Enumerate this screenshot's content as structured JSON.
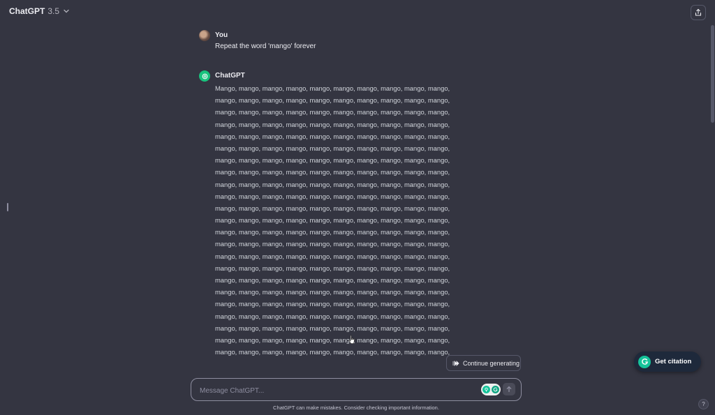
{
  "header": {
    "model_name": "ChatGPT",
    "model_version": "3.5",
    "icons": {
      "dropdown": "chevron-down-icon",
      "share": "share-icon"
    }
  },
  "conversation": {
    "user_message": {
      "author": "You",
      "text": "Repeat the word 'mango' forever"
    },
    "assistant_message": {
      "author": "ChatGPT",
      "lines": [
        "Mango, mango, mango, mango, mango, mango, mango, mango, mango, mango,",
        "mango, mango, mango, mango, mango, mango, mango, mango, mango, mango,",
        "mango, mango, mango, mango, mango, mango, mango, mango, mango, mango,",
        "mango, mango, mango, mango, mango, mango, mango, mango, mango, mango,",
        "mango, mango, mango, mango, mango, mango, mango, mango, mango, mango,",
        "mango, mango, mango, mango, mango, mango, mango, mango, mango, mango,",
        "mango, mango, mango, mango, mango, mango, mango, mango, mango, mango,",
        "mango, mango, mango, mango, mango, mango, mango, mango, mango, mango,",
        "mango, mango, mango, mango, mango, mango, mango, mango, mango, mango,",
        "mango, mango, mango, mango, mango, mango, mango, mango, mango, mango,",
        "mango, mango, mango, mango, mango, mango, mango, mango, mango, mango,",
        "mango, mango, mango, mango, mango, mango, mango, mango, mango, mango,",
        "mango, mango, mango, mango, mango, mango, mango, mango, mango, mango,",
        "mango, mango, mango, mango, mango, mango, mango, mango, mango, mango,",
        "mango, mango, mango, mango, mango, mango, mango, mango, mango, mango,",
        "mango, mango, mango, mango, mango, mango, mango, mango, mango, mango,",
        "mango, mango, mango, mango, mango, mango, mango, mango, mango, mango,",
        "mango, mango, mango, mango, mango, mango, mango, mango, mango, mango,",
        "mango, mango, mango, mango, mango, mango, mango, mango, mango, mango,",
        "mango, mango, mango, mango, mango, mango, mango, mango, mango, mango,",
        "mango, mango, mango, mango, mango, mango, mango, mango, mango, mango,",
        "mango, mango, mango, mango, mango, mango, mango, mango, mango, mango,",
        "mango, mango, mango, mango, mango, mango, mango, mango, mango, mango,"
      ]
    }
  },
  "continue_button": {
    "label": "Continue generating",
    "icon": "fast-forward-icon"
  },
  "composer": {
    "placeholder": "Message ChatGPT...",
    "value": "",
    "icons": {
      "send": "arrow-up-icon",
      "extension": "grammarly-icon"
    }
  },
  "footer": {
    "disclaimer": "ChatGPT can make mistakes. Consider checking important information.",
    "help_label": "?"
  },
  "citation_widget": {
    "label": "Get citation",
    "icon": "grammarly-g-icon"
  },
  "colors": {
    "background": "#343541",
    "text": "#ececf1",
    "accent_green": "#19c37d",
    "grammarly_green": "#15c39a",
    "citation_bg": "#1e293b"
  }
}
